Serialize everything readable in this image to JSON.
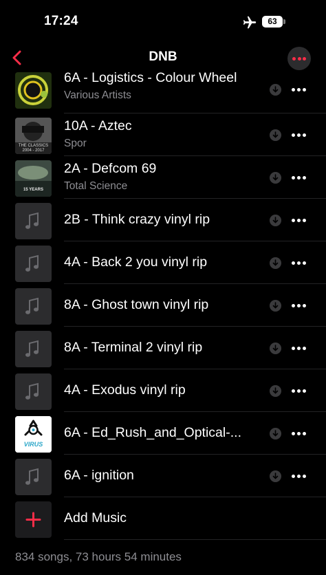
{
  "status": {
    "time": "17:24",
    "battery": "63"
  },
  "nav": {
    "title": "DNB"
  },
  "songs": [
    {
      "title": "6A - Logistics - Colour Wheel",
      "artist": "Various Artists",
      "art": "colour-wheel"
    },
    {
      "title": "10A - Aztec",
      "artist": "Spor",
      "art": "the-classics",
      "art_text": "THE CLASSICS\n2004 - 2017"
    },
    {
      "title": "2A - Defcom 69",
      "artist": "Total Science",
      "art": "15-years",
      "art_text": "15 YEARS"
    },
    {
      "title": "2B - Think crazy vinyl rip",
      "art": "placeholder"
    },
    {
      "title": "4A - Back 2 you vinyl rip",
      "art": "placeholder"
    },
    {
      "title": "8A - Ghost town vinyl rip",
      "art": "placeholder"
    },
    {
      "title": "8A - Terminal 2 vinyl rip",
      "art": "placeholder"
    },
    {
      "title": "4A - Exodus vinyl rip",
      "art": "placeholder"
    },
    {
      "title": "6A - Ed_Rush_and_Optical-...",
      "art": "virus",
      "art_text": "VIRUS"
    },
    {
      "title": "6A -  ignition",
      "art": "placeholder"
    }
  ],
  "add_music": {
    "label": "Add Music"
  },
  "footer": {
    "summary": "834 songs, 73 hours 54 minutes"
  },
  "colors": {
    "accent": "#fa2d48",
    "secondary_text": "#8e8e93",
    "background": "#000000"
  },
  "icons": [
    "back-chevron-icon",
    "more-icon",
    "airplane-icon",
    "download-icon",
    "music-note-icon",
    "plus-icon"
  ]
}
